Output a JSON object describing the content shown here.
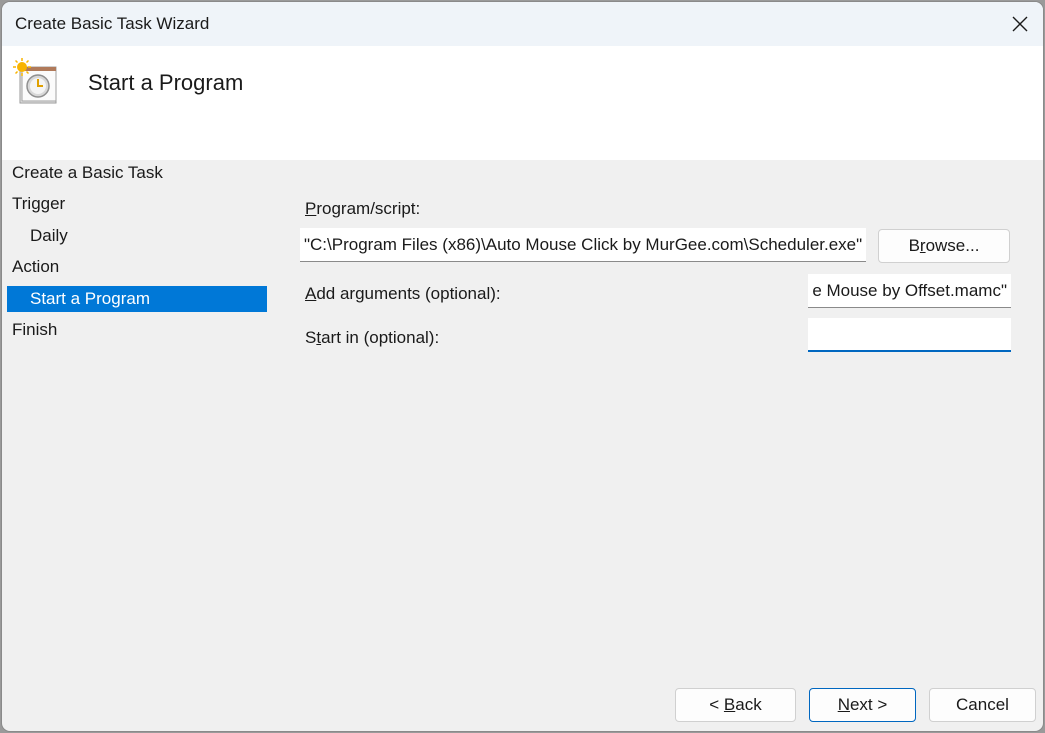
{
  "window": {
    "title": "Create Basic Task Wizard",
    "close_icon": "close-icon"
  },
  "header": {
    "title": "Start a Program",
    "icon": "task-scheduler-clock-icon"
  },
  "nav": {
    "items": [
      {
        "label": "Create a Basic Task",
        "level": 0,
        "selected": false
      },
      {
        "label": "Trigger",
        "level": 0,
        "selected": false
      },
      {
        "label": "Daily",
        "level": 1,
        "selected": false
      },
      {
        "label": "Action",
        "level": 0,
        "selected": false
      },
      {
        "label": "Start a Program",
        "level": 1,
        "selected": true
      },
      {
        "label": "Finish",
        "level": 0,
        "selected": false
      }
    ]
  },
  "form": {
    "program_label_mnemonic": "P",
    "program_label_rest": "rogram/script:",
    "program_value": "\"C:\\Program Files (x86)\\Auto Mouse Click by MurGee.com\\Scheduler.exe\"",
    "browse_pre": "B",
    "browse_mnemonic": "r",
    "browse_rest": "owse...",
    "args_label_mnemonic": "A",
    "args_label_rest": "dd arguments (optional):",
    "args_value": "e Mouse by Offset.mamc\"",
    "startin_label_pre": "S",
    "startin_label_mnemonic": "t",
    "startin_label_rest": "art in (optional):",
    "startin_value": ""
  },
  "footer": {
    "back_pre": "< ",
    "back_mnemonic": "B",
    "back_rest": "ack",
    "next_mnemonic": "N",
    "next_rest": "ext >",
    "cancel_label": "Cancel"
  },
  "colors": {
    "selection": "#0078d7",
    "focus_accent": "#0067c0"
  }
}
